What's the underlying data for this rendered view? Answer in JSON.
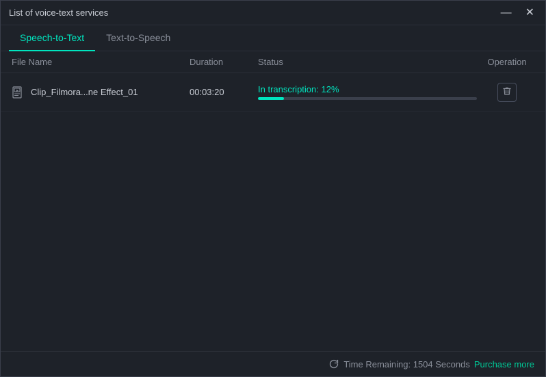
{
  "window": {
    "title": "List of voice-text services"
  },
  "controls": {
    "minimize_label": "—",
    "close_label": "✕"
  },
  "tabs": [
    {
      "id": "speech-to-text",
      "label": "Speech-to-Text",
      "active": true
    },
    {
      "id": "text-to-speech",
      "label": "Text-to-Speech",
      "active": false
    }
  ],
  "table": {
    "headers": {
      "filename": "File Name",
      "duration": "Duration",
      "status": "Status",
      "operation": "Operation"
    },
    "rows": [
      {
        "filename": "Clip_Filmora...ne Effect_01",
        "duration": "00:03:20",
        "status_text": "In transcription:  12%",
        "progress_percent": 12,
        "operation": "delete"
      }
    ]
  },
  "footer": {
    "time_remaining_label": "Time Remaining: 1504 Seconds",
    "purchase_label": "Purchase more"
  },
  "icons": {
    "file_icon": "file-video-icon",
    "delete_icon": "trash-icon",
    "refresh_icon": "refresh-icon"
  }
}
